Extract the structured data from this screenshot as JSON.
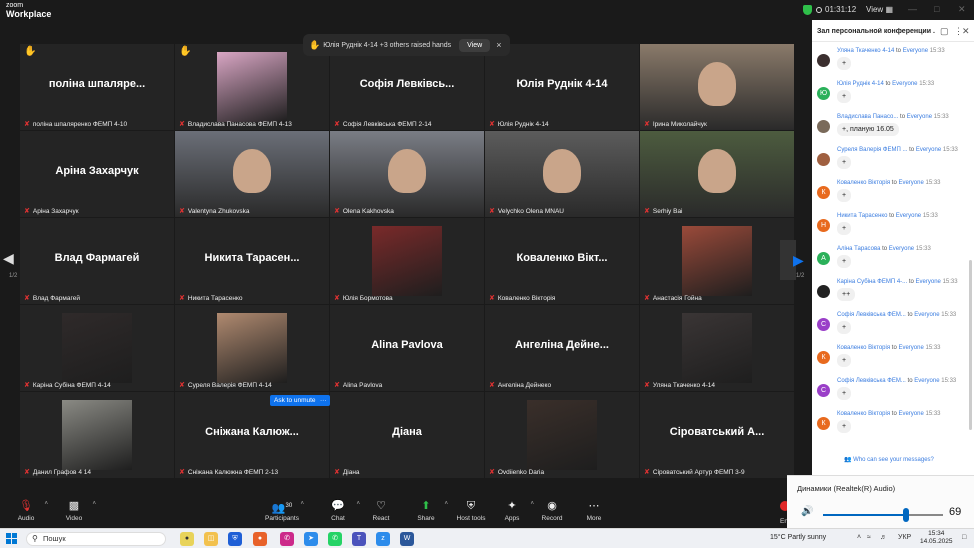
{
  "app": {
    "logo_line1": "zoom",
    "logo_line2": "Workplace",
    "timer": "01:31:12",
    "view_label": "View"
  },
  "hands_bar": {
    "text": "Юлія Руднік 4-14 +3 others raised hands",
    "view_label": "View",
    "close": "×"
  },
  "gallery": {
    "page_indicator": "1/2",
    "tiles": [
      {
        "big": "поліна шпаляре...",
        "label": "поліна шпаляренко ФЕМП 4-10",
        "hand": true
      },
      {
        "big": "",
        "label": "Владислава Панасова ФЕМП 4-13",
        "hand": true,
        "photo": "#d9a6c4"
      },
      {
        "big": "Софія Левківсь...",
        "label": "Софія Левківська ФЕМП 2-14"
      },
      {
        "big": "Юлія Руднік 4-14",
        "label": "Юлія Руднік 4-14"
      },
      {
        "big": "",
        "label": "Ірина Миколайчук",
        "video": "#8a7a6a"
      },
      {
        "big": "Аріна Захарчук",
        "label": "Аріна Захарчук"
      },
      {
        "big": "",
        "label": "Valentyna Zhukovska",
        "video": "#6b6f78"
      },
      {
        "big": "",
        "label": "Olena Kakhovska",
        "video": "#7a7d85"
      },
      {
        "big": "",
        "label": "Velychko Olena MNAU",
        "video": "#5c5c5c"
      },
      {
        "big": "",
        "label": "Serhiy Bai",
        "video": "#4d5c3f",
        "active": true
      },
      {
        "big": "Влад Фармагей",
        "label": "Влад Фармагей"
      },
      {
        "big": "Никита Тарасен...",
        "label": "Никита Тарасенко"
      },
      {
        "big": "",
        "label": "Юлія Бормотова",
        "photo": "#7a2a2a"
      },
      {
        "big": "Коваленко Вікт...",
        "label": "Коваленко Вікторія"
      },
      {
        "big": "",
        "label": "Анастасія Гойна",
        "photo": "#9a4a3a"
      },
      {
        "big": "",
        "label": "Каріна Субіна ФЕМП 4-14",
        "photo": "#2f2a2a"
      },
      {
        "big": "",
        "label": "Суреля Валерія ФЕМП 4-14",
        "photo": "#b08a70"
      },
      {
        "big": "Alina Pavlova",
        "label": "Alina Pavlova"
      },
      {
        "big": "Ангеліна Дейне...",
        "label": "Ангеліна Дейнеко"
      },
      {
        "big": "",
        "label": "Уляна Ткаченко 4-14",
        "photo": "#3a3535"
      },
      {
        "big": "",
        "label": "Данил Графов 4 14",
        "photo": "#8a8a84"
      },
      {
        "big": "Сніжана Калюж...",
        "label": "Сніжана Калюжна ФЕМП 2-13"
      },
      {
        "big": "Діана",
        "label": "Діана"
      },
      {
        "big": "",
        "label": "Ovdiienko Daria",
        "photo": "#3a2f2a"
      },
      {
        "big": "Сіроватський А...",
        "label": "Сіроватський Артур ФЕМП 3-9"
      }
    ],
    "ask_unmute": "Ask to unmute",
    "more": "···"
  },
  "toolbar": {
    "audio": "Audio",
    "video": "Video",
    "participants": "Participants",
    "participants_count": "30",
    "chat": "Chat",
    "react": "React",
    "share": "Share",
    "host_tools": "Host tools",
    "apps": "Apps",
    "record": "Record",
    "more": "More",
    "end": "End"
  },
  "chat": {
    "title": "Зал персональной конференции ...",
    "to_word": "to",
    "everyone": "Everyone",
    "messages": [
      {
        "sender": "Уляна Ткаченко 4-14",
        "time": "15:33",
        "text": "+",
        "avatar_color": "#3b2f2f",
        "initial": ""
      },
      {
        "sender": "Юлія Руднік 4-14",
        "time": "15:33",
        "text": "+",
        "avatar_color": "#2bb15a",
        "initial": "Ю"
      },
      {
        "sender": "Владислава Панасо...",
        "time": "15:33",
        "text": "+, планую 16.05",
        "avatar_color": "#7a6a5a",
        "initial": ""
      },
      {
        "sender": "Суреля Валерія ФЕМП ...",
        "time": "15:33",
        "text": "+",
        "avatar_color": "#a06040",
        "initial": ""
      },
      {
        "sender": "Коваленко Вікторія",
        "time": "15:33",
        "text": "+",
        "avatar_color": "#e86a1e",
        "initial": "К"
      },
      {
        "sender": "Никита Тарасенко",
        "time": "15:33",
        "text": "+",
        "avatar_color": "#e86a1e",
        "initial": "Н"
      },
      {
        "sender": "Аліна Тарасова",
        "time": "15:33",
        "text": "+",
        "avatar_color": "#2bb15a",
        "initial": "А"
      },
      {
        "sender": "Каріна Субіна ФЕМП 4-...",
        "time": "15:33",
        "text": "++",
        "avatar_color": "#222222",
        "initial": ""
      },
      {
        "sender": "Софія Левківська ФЕМ...",
        "time": "15:33",
        "text": "+",
        "avatar_color": "#9a3fc8",
        "initial": "С"
      },
      {
        "sender": "Коваленко Вікторія",
        "time": "15:33",
        "text": "+",
        "avatar_color": "#e86a1e",
        "initial": "К"
      },
      {
        "sender": "Софія Левківська ФЕМ...",
        "time": "15:33",
        "text": "+",
        "avatar_color": "#9a3fc8",
        "initial": "С"
      },
      {
        "sender": "Коваленко Вікторія",
        "time": "15:33",
        "text": "+",
        "avatar_color": "#e86a1e",
        "initial": "К"
      }
    ],
    "footer": "Who can see your messages?"
  },
  "audio": {
    "title": "Динамики (Realtek(R) Audio)",
    "volume": 69,
    "volume_label": "69"
  },
  "taskbar": {
    "search": "Пошук",
    "weather": "15°C  Partly sunny",
    "lang": "УКР",
    "time": "15:34",
    "date": "14.05.2025"
  },
  "colors": {
    "accent": "#0e72ed",
    "active_speaker": "#37c45f",
    "muted": "#e03232"
  }
}
